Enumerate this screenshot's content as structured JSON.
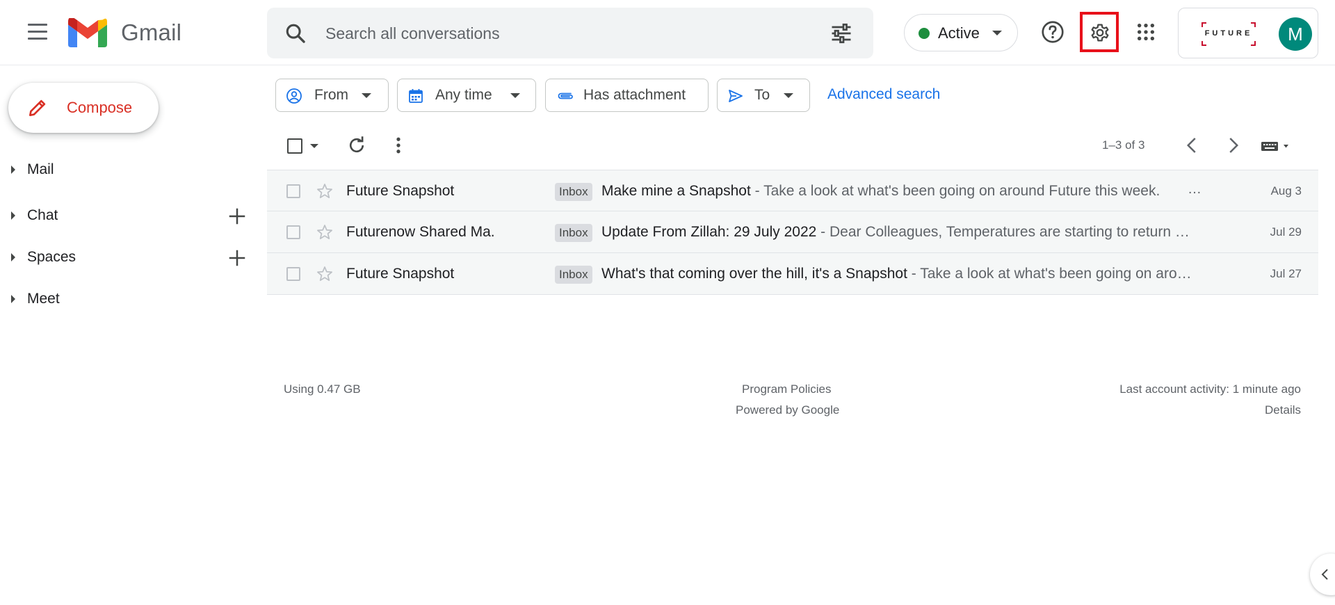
{
  "header": {
    "app_title": "Gmail",
    "search_placeholder": "Search all conversations",
    "status_label": "Active",
    "org_logo_text": "FUTURE",
    "avatar_initial": "M"
  },
  "colors": {
    "accent": "#1a73e8",
    "compose_red": "#d93025",
    "status_green": "#1e8e3e",
    "avatar_bg": "#00897b",
    "highlight_box": "#e8101a"
  },
  "sidebar": {
    "compose_label": "Compose",
    "items": [
      {
        "label": "Mail",
        "has_add": false
      },
      {
        "label": "Chat",
        "has_add": true
      },
      {
        "label": "Spaces",
        "has_add": true
      },
      {
        "label": "Meet",
        "has_add": false
      }
    ]
  },
  "filters": {
    "chips": [
      {
        "label": "From",
        "icon": "person-circle-icon",
        "dropdown": true
      },
      {
        "label": "Any time",
        "icon": "calendar-icon",
        "dropdown": true
      },
      {
        "label": "Has attachment",
        "icon": "paperclip-icon",
        "dropdown": false
      },
      {
        "label": "To",
        "icon": "send-icon",
        "dropdown": true
      }
    ],
    "advanced_search": "Advanced search"
  },
  "toolbar": {
    "pagination": "1–3 of 3"
  },
  "emails": [
    {
      "sender": "Future Snapshot",
      "label": "Inbox",
      "subject": "Make mine a Snapshot",
      "snippet": " - Take a look at what's been going on around Future this week.",
      "trailing": "…",
      "date": "Aug 3"
    },
    {
      "sender": "Futurenow Shared Ma.",
      "label": "Inbox",
      "subject": "Update From Zillah: 29 July 2022",
      "snippet": " - Dear Colleagues, Temperatures are starting to return …",
      "trailing": "",
      "date": "Jul 29"
    },
    {
      "sender": "Future Snapshot",
      "label": "Inbox",
      "subject": "What's that coming over the hill, it's a Snapshot",
      "snippet": " - Take a look at what's been going on aro…",
      "trailing": "",
      "date": "Jul 27"
    }
  ],
  "footer": {
    "storage": "Using 0.47 GB",
    "program_policies": "Program Policies",
    "powered_by": "Powered by Google",
    "last_activity": "Last account activity: 1 minute ago",
    "details": "Details"
  }
}
